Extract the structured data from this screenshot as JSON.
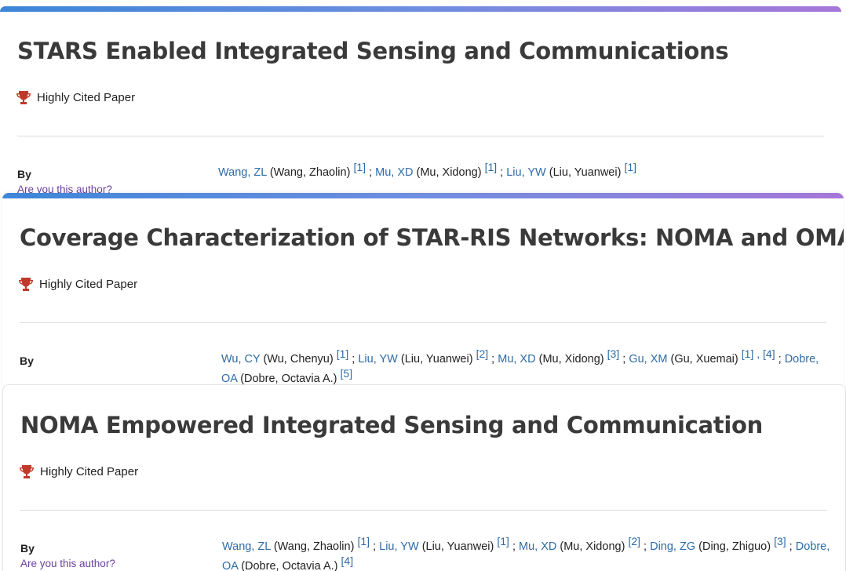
{
  "cards": [
    {
      "title": "STARS Enabled Integrated Sensing and Communications",
      "badge": "Highly Cited Paper",
      "by_label": "By",
      "author_prompt": "Are you this author?",
      "authors": [
        {
          "abbr": "Wang, ZL",
          "full": "(Wang, Zhaolin)",
          "refs": "[1]"
        },
        {
          "abbr": "Mu, XD",
          "full": "(Mu, Xidong)",
          "refs": "[1]"
        },
        {
          "abbr": "Liu, YW",
          "full": "(Liu, Yuanwei)",
          "refs": "[1]"
        }
      ]
    },
    {
      "title": "Coverage Characterization of STAR-RIS Networks: NOMA and OMA",
      "badge": "Highly Cited Paper",
      "by_label": "By",
      "authors": [
        {
          "abbr": "Wu, CY",
          "full": "(Wu, Chenyu)",
          "refs": "[1]"
        },
        {
          "abbr": "Liu, YW",
          "full": "(Liu, Yuanwei)",
          "refs": "[2]"
        },
        {
          "abbr": "Mu, XD",
          "full": "(Mu, Xidong)",
          "refs": "[3]"
        },
        {
          "abbr": "Gu, XM",
          "full": "(Gu, Xuemai)",
          "refs": "[1] , [4]"
        },
        {
          "abbr": "Dobre, OA",
          "full": "(Dobre, Octavia A.)",
          "refs": "[5]"
        }
      ]
    },
    {
      "title": "NOMA Empowered Integrated Sensing and Communication",
      "badge": "Highly Cited Paper",
      "by_label": "By",
      "author_prompt": "Are you this author?",
      "authors": [
        {
          "abbr": "Wang, ZL",
          "full": "(Wang, Zhaolin)",
          "refs": "[1]"
        },
        {
          "abbr": "Liu, YW",
          "full": "(Liu, Yuanwei)",
          "refs": "[1]"
        },
        {
          "abbr": "Mu, XD",
          "full": "(Mu, Xidong)",
          "refs": "[2]"
        },
        {
          "abbr": "Ding, ZG",
          "full": "(Ding, Zhiguo)",
          "refs": "[3]"
        },
        {
          "abbr": "Dobre, OA",
          "full": "(Dobre, Octavia A.)",
          "refs": "[4]"
        }
      ]
    }
  ],
  "colors": {
    "accent_start": "#3d86d8",
    "accent_end": "#a576d8",
    "author_link": "#2e6ba6",
    "trophy": "#c0392b"
  },
  "icons": {
    "badge": "trophy-icon"
  }
}
